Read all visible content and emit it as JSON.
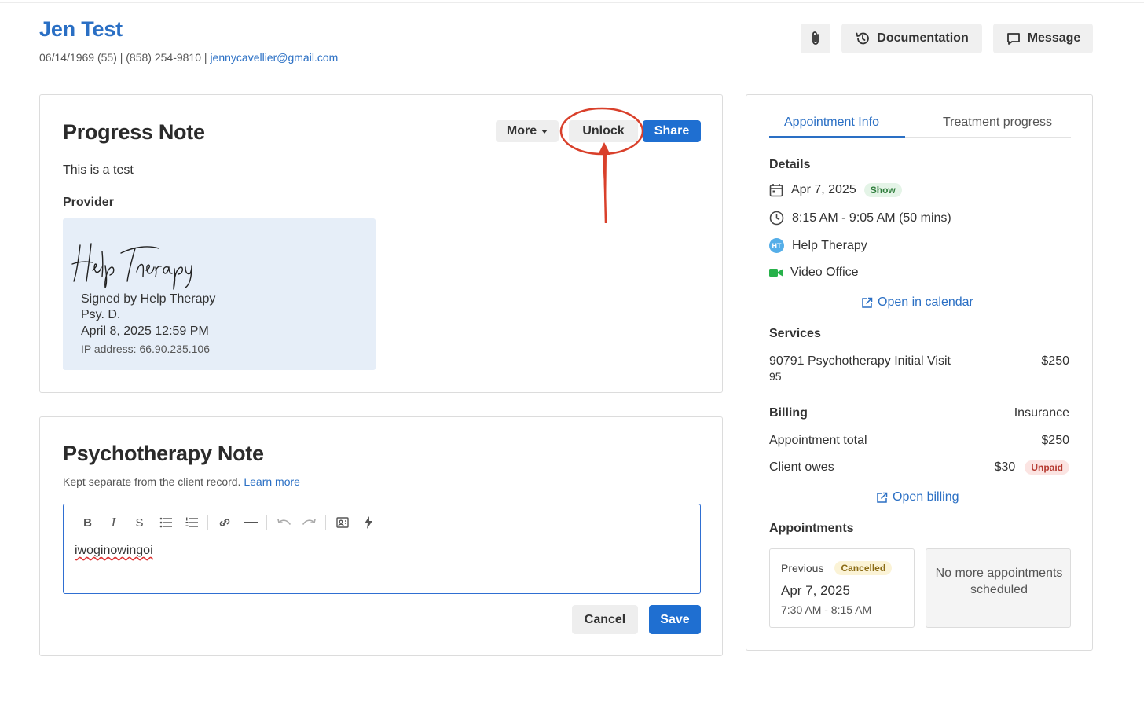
{
  "client": {
    "name": "Jen Test",
    "meta_prefix": "06/14/1969 (55) | (858) 254-9810 | ",
    "email": "jennycavellier@gmail.com"
  },
  "header": {
    "documentation_label": "Documentation",
    "message_label": "Message"
  },
  "progress_note": {
    "title": "Progress Note",
    "more_label": "More",
    "unlock_label": "Unlock",
    "share_label": "Share",
    "body": "This is a test",
    "provider_heading": "Provider",
    "signature": {
      "signed_by": "Signed by Help Therapy",
      "credential": "Psy. D.",
      "date": "April 8, 2025 12:59 PM",
      "ip": "IP address: 66.90.235.106"
    }
  },
  "psychotherapy_note": {
    "title": "Psychotherapy Note",
    "subtitle": "Kept separate from the client record.",
    "learn_more": "Learn more",
    "editor_text": "iwoginowingoi",
    "toolbar": [
      "bold-icon",
      "italic-icon",
      "strikethrough-icon",
      "bullet-list-icon",
      "numbered-list-icon",
      "link-icon",
      "horizontal-rule-icon",
      "undo-icon",
      "redo-icon",
      "client-info-icon",
      "lightning-icon"
    ],
    "cancel_label": "Cancel",
    "save_label": "Save"
  },
  "sidebar": {
    "tabs": [
      {
        "label": "Appointment Info",
        "active": true
      },
      {
        "label": "Treatment progress",
        "active": false
      }
    ],
    "details_heading": "Details",
    "date": "Apr 7, 2025",
    "status_badge": "Show",
    "time": "8:15 AM - 9:05 AM (50 mins)",
    "provider_initials": "HT",
    "provider": "Help Therapy",
    "location": "Video Office",
    "open_calendar": "Open in calendar",
    "services_heading": "Services",
    "service_name": "90791 Psychotherapy Initial Visit",
    "service_code": "95",
    "service_price": "$250",
    "billing_heading": "Billing",
    "billing_type": "Insurance",
    "appt_total_label": "Appointment total",
    "appt_total_value": "$250",
    "client_owes_label": "Client owes",
    "client_owes_value": "$30",
    "unpaid_badge": "Unpaid",
    "open_billing": "Open billing",
    "appointments_heading": "Appointments",
    "previous_label": "Previous",
    "previous_badge": "Cancelled",
    "previous_date": "Apr 7, 2025",
    "previous_time": "7:30 AM - 8:15 AM",
    "no_more": "No more appointments scheduled"
  },
  "colors": {
    "accent": "#2a6fc4",
    "primary_button": "#1f6fd1",
    "annotation": "#d9402b"
  }
}
